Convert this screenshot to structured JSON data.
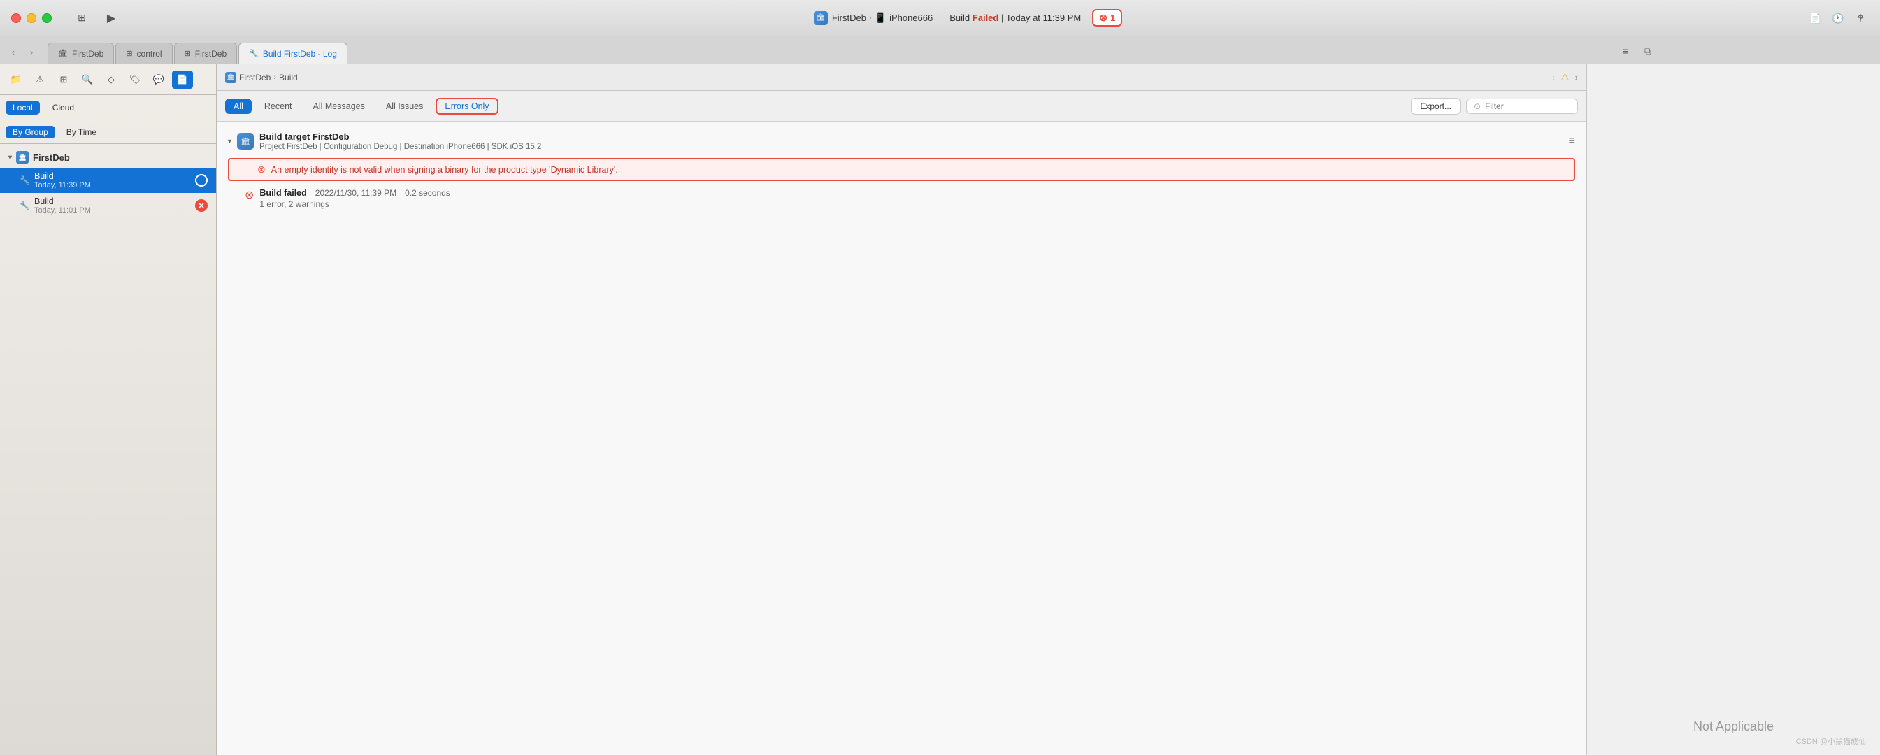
{
  "titlebar": {
    "traffic_lights": [
      "close",
      "minimize",
      "maximize"
    ],
    "app_name": "FirstDeb",
    "breadcrumb_arrow": "›",
    "device_name": "iPhone666",
    "build_status_prefix": "Build",
    "build_status_state": "Failed",
    "build_status_separator": "|",
    "build_status_time": "Today at 11:39 PM",
    "error_count": "1",
    "play_icon": "▶",
    "sidebar_icon": "⊞",
    "split_icon": "⧉",
    "add_tab_icon": "+"
  },
  "tabs": [
    {
      "id": "firstdeb",
      "label": "FirstDeb",
      "icon": "🏛",
      "active": false
    },
    {
      "id": "control",
      "label": "control",
      "icon": "⊞",
      "active": false
    },
    {
      "id": "firstdeb2",
      "label": "FirstDeb",
      "icon": "⊞",
      "active": false
    },
    {
      "id": "build-log",
      "label": "Build FirstDeb - Log",
      "icon": "🔧",
      "active": true
    }
  ],
  "tabbar_icons": {
    "lines": "≡",
    "split": "⧉",
    "doc": "📄",
    "clock": "🕐",
    "help": "?"
  },
  "sidebar": {
    "tools": [
      {
        "id": "folder",
        "label": "📁",
        "active": false
      },
      {
        "id": "warn",
        "label": "⚠",
        "active": false
      },
      {
        "id": "grid",
        "label": "⊞",
        "active": false
      },
      {
        "id": "search",
        "label": "🔍",
        "active": false
      },
      {
        "id": "diamond",
        "label": "◇",
        "active": false
      },
      {
        "id": "tag",
        "label": "🏷",
        "active": false
      },
      {
        "id": "bubble",
        "label": "💬",
        "active": false
      },
      {
        "id": "doc",
        "label": "📄",
        "active": true
      }
    ],
    "scope": {
      "local": "Local",
      "cloud": "Cloud"
    },
    "scope_active": "local",
    "group": {
      "by_group": "By Group",
      "by_time": "By Time"
    },
    "group_active": "by_group",
    "project_name": "FirstDeb",
    "items": [
      {
        "id": "build-selected",
        "icon": "🔧",
        "label": "Build",
        "time": "Today, 11:39 PM",
        "badge": "",
        "selected": true,
        "badge_type": "selected-outline"
      },
      {
        "id": "build-old",
        "icon": "🔧",
        "label": "Build",
        "time": "Today, 11:01 PM",
        "badge": "✕",
        "selected": false,
        "badge_type": "red-filled"
      }
    ]
  },
  "breadcrumb": {
    "items": [
      "FirstDeb",
      "Build"
    ],
    "separator": "›"
  },
  "filter_tabs": [
    {
      "id": "all",
      "label": "All",
      "active": true
    },
    {
      "id": "recent",
      "label": "Recent",
      "active": false
    },
    {
      "id": "all-messages",
      "label": "All Messages",
      "active": false
    },
    {
      "id": "all-issues",
      "label": "All Issues",
      "active": false
    },
    {
      "id": "errors-only",
      "label": "Errors Only",
      "active": false
    }
  ],
  "filter_bar": {
    "export_label": "Export...",
    "filter_icon": "⊙",
    "filter_placeholder": "Filter"
  },
  "build_log": {
    "section_title": "Build target FirstDeb",
    "section_sub": "Project FirstDeb | Configuration Debug | Destination iPhone666 | SDK iOS 15.2",
    "error_message": "An empty identity is not valid when signing a binary for the product type 'Dynamic Library'.",
    "build_failed_label": "Build failed",
    "build_failed_date": "2022/11/30, 11:39 PM",
    "build_failed_duration": "0.2 seconds",
    "build_failed_summary": "1 error, 2 warnings"
  },
  "right_panel": {
    "not_applicable": "Not Applicable"
  },
  "watermark": {
    "text": "CSDN @小黑猫成仙"
  }
}
